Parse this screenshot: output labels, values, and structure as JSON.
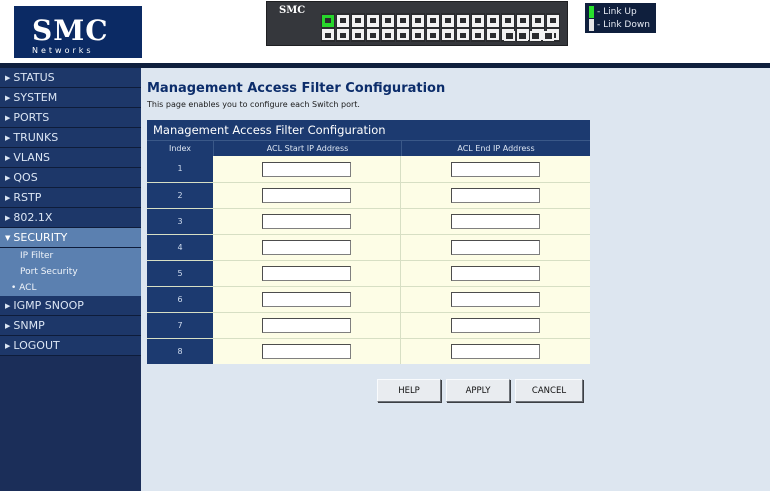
{
  "header": {
    "logo": {
      "text": "SMC",
      "subtext": "Networks"
    },
    "switch_panel": {
      "brand": "SMC",
      "port_groups": 3,
      "ports_per_group": 6,
      "link_up_ports": [
        1
      ],
      "sfp_ports": 4
    },
    "legend": [
      {
        "label": "- Link Up",
        "color": "#29e02d"
      },
      {
        "label": "- Link Down",
        "color": "#e6e6e6"
      }
    ]
  },
  "sidebar": {
    "items": [
      {
        "label": "STATUS",
        "expanded": false
      },
      {
        "label": "SYSTEM",
        "expanded": false
      },
      {
        "label": "PORTS",
        "expanded": false
      },
      {
        "label": "TRUNKS",
        "expanded": false
      },
      {
        "label": "VLANS",
        "expanded": false
      },
      {
        "label": "QOS",
        "expanded": false
      },
      {
        "label": "RSTP",
        "expanded": false
      },
      {
        "label": "802.1X",
        "expanded": false
      },
      {
        "label": "SECURITY",
        "expanded": true,
        "subitems": [
          {
            "label": "IP Filter",
            "active": false
          },
          {
            "label": "Port Security",
            "active": false
          },
          {
            "label": "ACL",
            "active": true
          }
        ]
      },
      {
        "label": "IGMP SNOOP",
        "expanded": false
      },
      {
        "label": "SNMP",
        "expanded": false
      },
      {
        "label": "LOGOUT",
        "expanded": false
      }
    ]
  },
  "main": {
    "title": "Management Access Filter Configuration",
    "description": "This page enables you to configure each Switch port.",
    "table": {
      "caption": "Management Access Filter Configuration",
      "columns": [
        "Index",
        "ACL Start IP Address",
        "ACL End IP Address"
      ],
      "rows": [
        {
          "index": "1",
          "start_ip": "",
          "end_ip": ""
        },
        {
          "index": "2",
          "start_ip": "",
          "end_ip": ""
        },
        {
          "index": "3",
          "start_ip": "",
          "end_ip": ""
        },
        {
          "index": "4",
          "start_ip": "",
          "end_ip": ""
        },
        {
          "index": "5",
          "start_ip": "",
          "end_ip": ""
        },
        {
          "index": "6",
          "start_ip": "",
          "end_ip": ""
        },
        {
          "index": "7",
          "start_ip": "",
          "end_ip": ""
        },
        {
          "index": "8",
          "start_ip": "",
          "end_ip": ""
        }
      ]
    },
    "buttons": {
      "help": "HELP",
      "apply": "APPLY",
      "cancel": "CANCEL"
    }
  },
  "colors": {
    "sidebar_bg": "#1d3769",
    "sidebar_expanded": "#5b80b0",
    "table_header": "#1c3a70",
    "table_cell": "#fdfde6",
    "content_bg": "#dde6f0",
    "title_text": "#0c2d6b"
  }
}
